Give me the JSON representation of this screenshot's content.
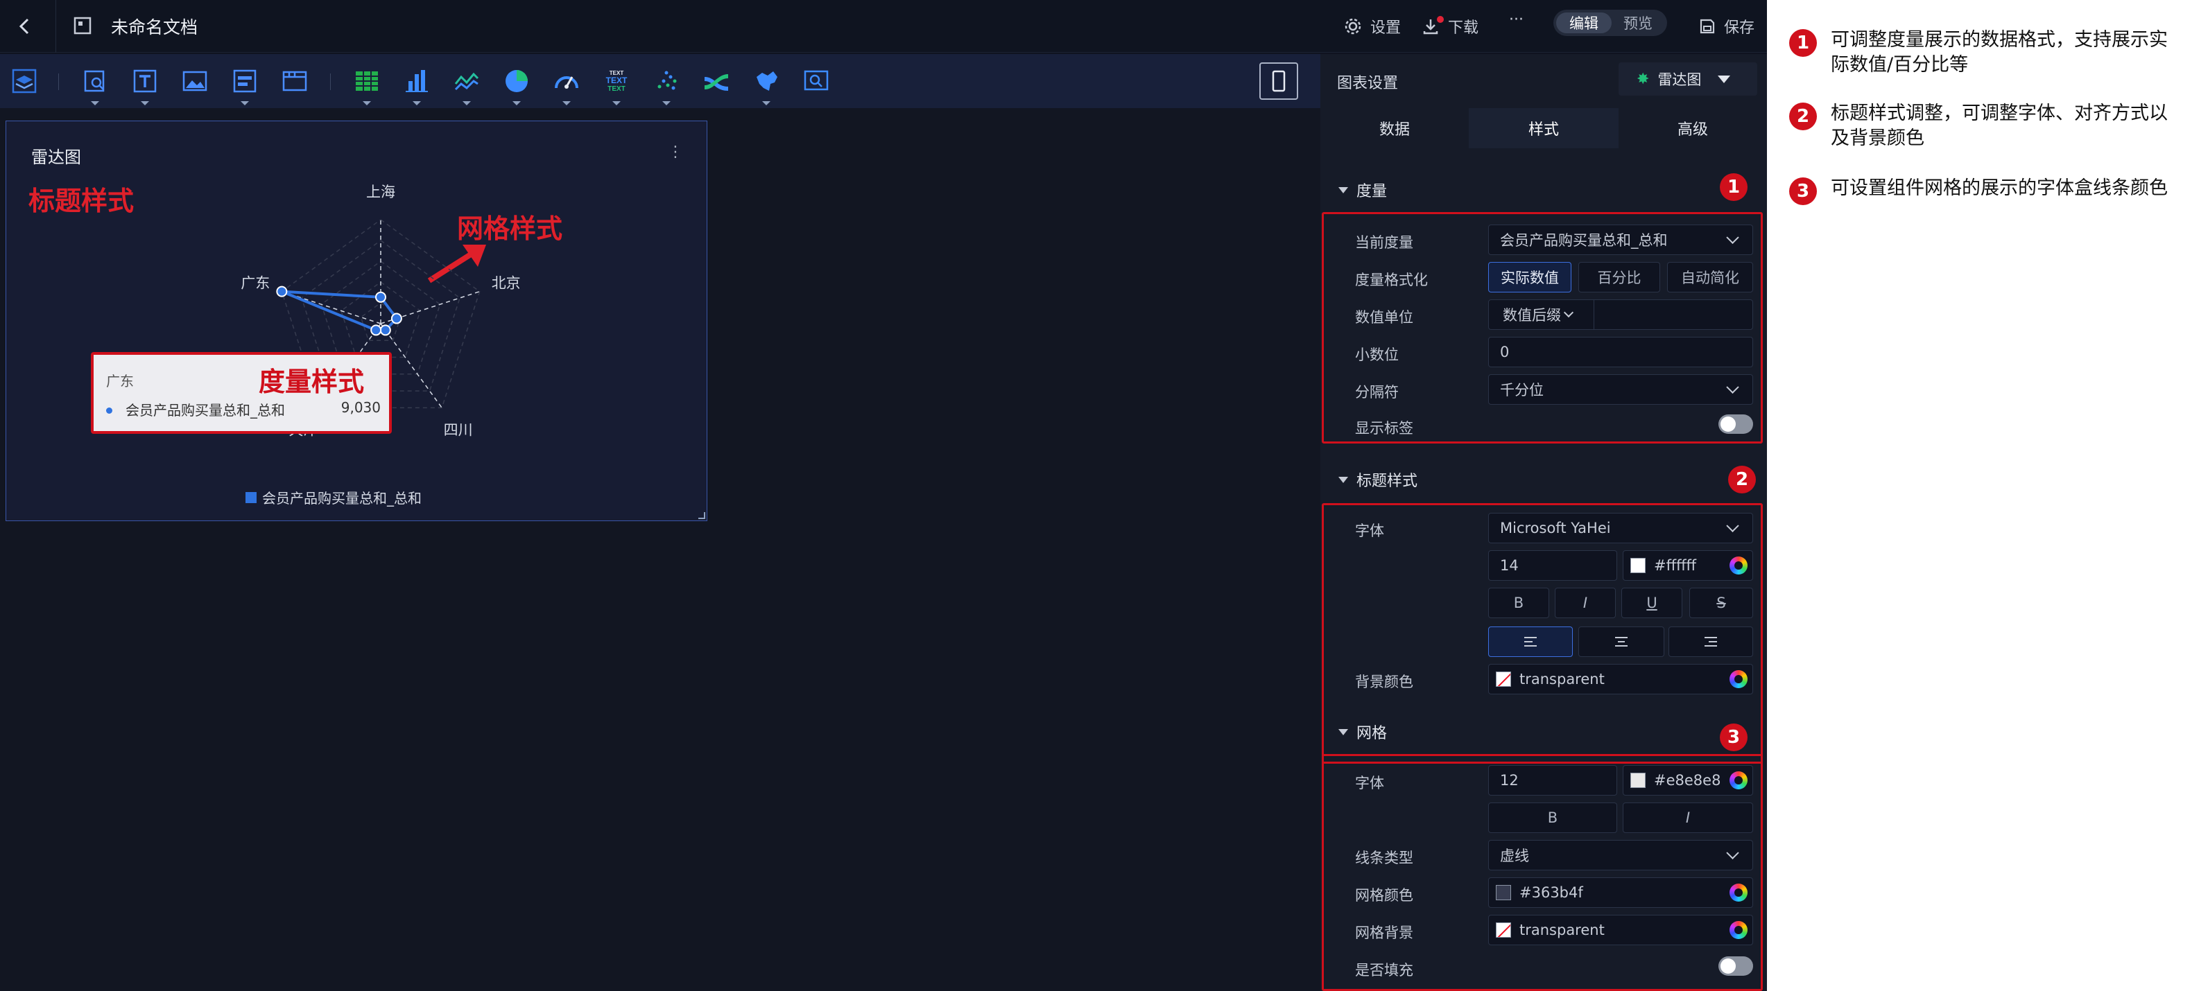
{
  "header": {
    "doc_title": "未命名文档",
    "settings_label": "设置",
    "download_label": "下载",
    "more_label": "···",
    "mode_edit": "编辑",
    "mode_preview": "预览",
    "save_label": "保存"
  },
  "toolbar": {
    "icons": [
      "layers-icon",
      "filter-search-icon",
      "text-icon",
      "image-icon",
      "list-card-icon",
      "window-icon",
      "table-icon",
      "bar-chart-icon",
      "line-chart-icon",
      "pie-chart-icon",
      "gauge-icon",
      "text-cloud-icon",
      "scatter-icon",
      "sankey-icon",
      "map-icon",
      "zoom-area-icon"
    ],
    "text_icon_words": [
      "TEXT",
      "TEXT",
      "TEXT"
    ]
  },
  "widget": {
    "title": "雷达图",
    "menu": "⋮",
    "annotation_title_style": "标题样式",
    "annotation_grid_style": "网格样式",
    "annotation_measure_style": "度量样式",
    "tooltip": {
      "category": "广东",
      "series": "会员产品购买量总和_总和",
      "value": "9,030"
    }
  },
  "chart_data": {
    "type": "radar",
    "categories": [
      "上海",
      "北京",
      "四川",
      "天津",
      "广东"
    ],
    "series": [
      {
        "name": "会员产品购买量总和_总和",
        "values": [
          2300,
          1450,
          700,
          700,
          9030
        ]
      }
    ],
    "legend": "bottom-center",
    "grid_line_type": "dashed",
    "grid_color": "#363b4f",
    "series_color": "#2f73e0",
    "title": "雷达图"
  },
  "panel": {
    "title": "图表设置",
    "chart_type": "雷达图",
    "tabs": [
      "数据",
      "样式",
      "高级"
    ],
    "active_tab": "样式",
    "measure": {
      "section": "度量",
      "current_label": "当前度量",
      "current_value": "会员产品购买量总和_总和",
      "format_label": "度量格式化",
      "format_options": [
        "实际数值",
        "百分比",
        "自动简化"
      ],
      "format_selected": "实际数值",
      "unit_label": "数值单位",
      "unit_value": "数值后缀",
      "decimal_label": "小数位",
      "decimal_value": "0",
      "separator_label": "分隔符",
      "separator_value": "千分位",
      "show_label_label": "显示标签",
      "show_label_on": false
    },
    "title_style": {
      "section": "标题样式",
      "font_label": "字体",
      "font_value": "Microsoft YaHei",
      "size_value": "14",
      "color_value": "#ffffff",
      "style_buttons": [
        "B",
        "I",
        "U",
        "S"
      ],
      "align_buttons": [
        "left-align-icon",
        "center-align-icon",
        "right-align-icon"
      ],
      "align_selected": "left",
      "bg_label": "背景颜色",
      "bg_value": "transparent"
    },
    "grid": {
      "section": "网格",
      "font_label": "字体",
      "size_value": "12",
      "color_value": "#e8e8e8",
      "style_buttons": [
        "B",
        "I"
      ],
      "line_label": "线条类型",
      "line_value": "虚线",
      "color_label": "网格颜色",
      "grid_color_value": "#363b4f",
      "bg_label": "网格背景",
      "bg_value": "transparent",
      "fill_label": "是否填充",
      "fill_on": false
    }
  },
  "notes": [
    {
      "num": "1",
      "text": "可调整度量展示的数据格式，支持展示实际数值/百分比等"
    },
    {
      "num": "2",
      "text": "标题样式调整，可调整字体、对齐方式以及背景颜色"
    },
    {
      "num": "3",
      "text": "可设置组件网格的展示的字体盒线条颜色"
    }
  ],
  "colors": {
    "accent": "#2f73e0",
    "annotation_red": "#d0101c",
    "panel_bg": "#161b28"
  }
}
